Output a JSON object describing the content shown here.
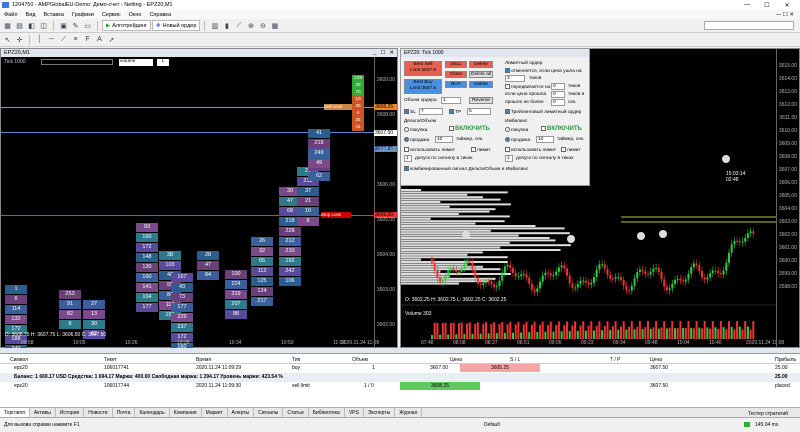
{
  "window": {
    "title": "1204750 - AMPGlobalEU-Demo: Демо-счет - Netting - EPZ20,M1"
  },
  "menu": [
    "Файл",
    "Вид",
    "Вставка",
    "Графики",
    "Сервис",
    "Окно",
    "Справка"
  ],
  "toolbar": {
    "algo": "Алготрейдинг",
    "new_order": "Новый ордер"
  },
  "chart_tab": {
    "title": "EPZ20,M1"
  },
  "left_chart": {
    "tick_label": "Tick 1000",
    "indicator": "volume",
    "prices": [
      "3609.00",
      "3608.00",
      "3607.00",
      "3606.00",
      "3605.00",
      "3604.00",
      "3603.00",
      "3602.00"
    ],
    "tags": {
      "sell_limit": "Sell Limit",
      "sell_limit_price": "3608.25",
      "current": "3607.50",
      "bid": "3607.25",
      "stop": "3606.50"
    },
    "top_right_cells": [
      "139",
      "28",
      "70",
      "10",
      "35",
      "4",
      "35",
      "41"
    ],
    "clusters": [
      [
        "1",
        "6",
        "114",
        "132",
        "172",
        "188",
        "249",
        "208"
      ],
      [
        "253",
        "91",
        "82",
        "8"
      ],
      [
        "27",
        "13",
        "30",
        "62"
      ],
      [
        "93",
        "160",
        "172",
        "148",
        "130",
        "160",
        "141",
        "104",
        "177"
      ],
      [
        "38",
        "103",
        "48",
        "59",
        "84",
        "118",
        "155"
      ],
      [
        "167",
        "43",
        "73",
        "177",
        "229",
        "237",
        "172",
        "160"
      ],
      [
        "28",
        "47",
        "84"
      ],
      [
        "100",
        "224",
        "319",
        "207",
        "88"
      ],
      [
        "26",
        "32",
        "65",
        "112",
        "125",
        "124",
        "217"
      ],
      [
        "30",
        "47",
        "68",
        "218",
        "228",
        "212",
        "210",
        "192",
        "242",
        "106"
      ],
      [
        "27",
        "213",
        "37",
        "21",
        "10",
        "8"
      ],
      [
        "72",
        "109",
        "215",
        "62"
      ],
      [
        "41",
        "219",
        "249",
        "49"
      ]
    ],
    "ohlc": "D: 3606.75  H: 3607.75  L: 3606.50  C: 3607.50",
    "times": [
      "09:58",
      "10:05",
      "10:26",
      "10:28",
      "10:34",
      "10:50",
      "11:02"
    ],
    "date": "2020.11.24 11:09"
  },
  "trade_panel": {
    "title": "EPZ20: Tick 1000",
    "best_sell": "Best Sell",
    "best_sell_limit": "Limit 3607.5",
    "sell": "SELL",
    "delete": "Delete",
    "close": "Close",
    "delete_all": "Delete all",
    "best_buy": "Best Buy",
    "best_buy_limit": "Limit 3607.5",
    "buy": "BUY",
    "delete2": "Delete",
    "limit_order": "Лимитный ордер",
    "track": "отменяется, если цена ушла на",
    "ticks": "тиков",
    "move_to": "передвигается на",
    "ticks2": "тиков",
    "if_price": "если цена прошла",
    "ticks3": "тиков и",
    "time_passed": "прошло не более",
    "sec": "сек.",
    "trailing": "Трейлинговый лимитный ордер",
    "volume_label": "Объем ордера",
    "volume_val": "1",
    "reverse": "Reverse",
    "sl": "SL",
    "sl_val": "7",
    "tp": "TP",
    "tp_val": "5",
    "delta_label": "Дельта/Объем",
    "imbalance": "Имбаланс",
    "buy_opt": "покупка",
    "sell_opt": "продажа",
    "enable": "ВКЛЮЧИТЬ",
    "enable2": "ВКЛЮЧИТЬ",
    "timer": "таймер, сек.",
    "timer_val": "10",
    "timer_val2": "10",
    "use_delta": "использовать лимит",
    "limit": "лимит",
    "use_delta2": "использовать лимит",
    "limit2": "лимит",
    "signal": "допуск по сигналу в тиках",
    "signal2": "допуск по сигналу в тиках",
    "combined": "комбинированный сигнал Дельта/Объем и Имбаланс"
  },
  "right_chart": {
    "prices": [
      "3615.00",
      "3614.00",
      "3613.00",
      "3612.00",
      "3611.00",
      "3610.00",
      "3609.00",
      "3608.00",
      "3607.00",
      "3606.00",
      "3605.00",
      "3604.00",
      "3603.00",
      "3602.00",
      "3601.00",
      "3600.00",
      "3599.00",
      "3598.00"
    ],
    "time_tag": "15:03:14",
    "time_tag2": "02:48",
    "ohlc": "O: 3602.25  H: 3602.75  L: 3602.25  C: 3602.25",
    "volume": "Volume 303",
    "times": [
      "07:48",
      "08:08",
      "08:27",
      "08:51",
      "09:05",
      "09:23",
      "09:34",
      "09:48",
      "10:04",
      "10:40"
    ],
    "date": "2020.11.24 11:09"
  },
  "toolbox": {
    "headers": [
      "Символ",
      "Тикет",
      "Время",
      "Тип",
      "Объем",
      "Цена",
      "S / L",
      "T / P",
      "Цена",
      "Прибыль"
    ],
    "row1": {
      "symbol": "epz20",
      "ticket": "106017741",
      "time": "2020.11.24 11:09:29",
      "type": "buy",
      "volume": "1",
      "price": "3607.00",
      "sl": "3605.25",
      "tp": "",
      "cur": "3607.50",
      "profit": "25.00"
    },
    "balance": "Баланс: 1 669.17 USD  Средства: 1 694.17  Маржа: 400.00  Свободная маржа: 1 294.17  Уровень маржи: 423.54 %",
    "balance_profit": "25.00",
    "row2": {
      "symbol": "epz20",
      "ticket": "106017744",
      "time": "2020.11.24 11:09:30",
      "type": "sell limit",
      "volume": "1 / 0",
      "price": "3608.25",
      "cur": "3607.50",
      "status": "placed"
    }
  },
  "tabs": [
    "Торговля",
    "Активы",
    "История",
    "Новости",
    "Почта",
    "Календарь",
    "Компания",
    "Маркет",
    "Алерты",
    "Сигналы",
    "Статьи",
    "Библиотека",
    "VPS",
    "Эксперты",
    "Журнал"
  ],
  "status": {
    "help": "Для вызова справки нажмите F1",
    "profile": "Default",
    "tester": "Тестер стратегий",
    "ping": "145.04 ms"
  }
}
